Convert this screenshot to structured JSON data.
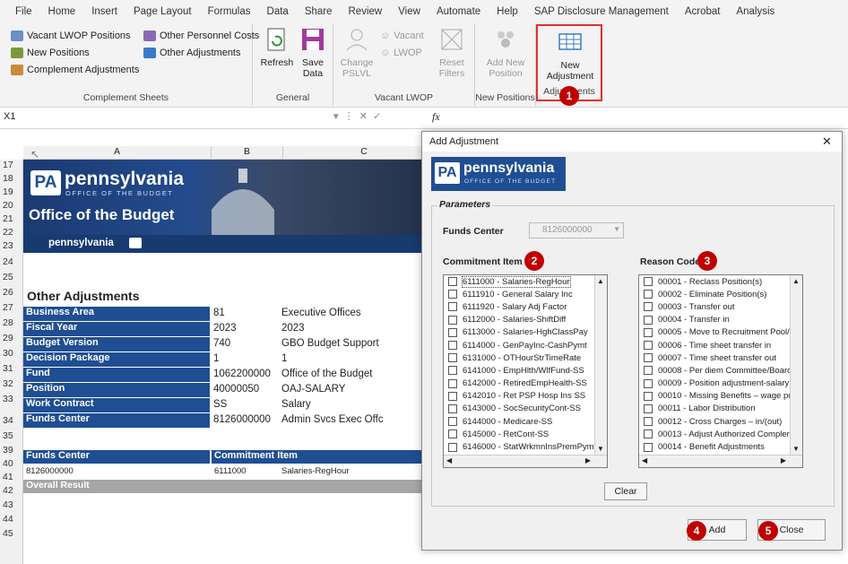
{
  "menu": [
    "File",
    "Home",
    "Insert",
    "Page Layout",
    "Formulas",
    "Data",
    "Share",
    "Review",
    "View",
    "Automate",
    "Help",
    "SAP Disclosure Management",
    "Acrobat",
    "Analysis"
  ],
  "ribbon": {
    "complement": {
      "items": [
        "Vacant LWOP Positions",
        "New Positions",
        "Complement Adjustments",
        "Other Personnel Costs",
        "Other Adjustments"
      ],
      "label": "Complement Sheets"
    },
    "general": {
      "refresh": "Refresh",
      "save1": "Save",
      "save2": "Data",
      "label": "General"
    },
    "vacant": {
      "change1": "Change",
      "change2": "PSLVL",
      "vacant_btn": "Vacant",
      "lwop_btn": "LWOP",
      "reset1": "Reset",
      "reset2": "Filters",
      "label": "Vacant LWOP"
    },
    "newpos": {
      "add1": "Add New",
      "add2": "Position",
      "label": "New Positions"
    },
    "adjust": {
      "new1": "New",
      "new2": "Adjustment",
      "label": "Adjustments"
    }
  },
  "formula": {
    "namebox": "X1",
    "fx": "fx"
  },
  "sheet": {
    "cols": [
      "A",
      "B",
      "C"
    ],
    "rows": [
      "17",
      "18",
      "19",
      "20",
      "21",
      "22",
      "23",
      "24",
      "25",
      "26",
      "27",
      "28",
      "29",
      "30",
      "31",
      "32",
      "33",
      "34",
      "35",
      "39",
      "40",
      "41",
      "42",
      "43",
      "44",
      "45"
    ],
    "banner": {
      "pa": "PA",
      "brand": "pennsylvania",
      "sub": "OFFICE OF THE BUDGET",
      "office": "Office of the Budget",
      "footer": "pennsylvania"
    },
    "title": "Other Adjustments",
    "fields": [
      {
        "label": "Business Area",
        "code": "81",
        "desc": "Executive Offices"
      },
      {
        "label": "Fiscal Year",
        "code": "2023",
        "desc": "2023"
      },
      {
        "label": "Budget Version",
        "code": "740",
        "desc": "GBO Budget Support"
      },
      {
        "label": "Decision Package",
        "code": "1",
        "desc": "1"
      },
      {
        "label": "Fund",
        "code": "1062200000",
        "desc": "Office of the Budget"
      },
      {
        "label": "Position",
        "code": "40000050",
        "desc": "OAJ-SALARY"
      },
      {
        "label": "Work Contract",
        "code": "SS",
        "desc": "Salary"
      },
      {
        "label": "Funds Center",
        "code": "8126000000",
        "desc": "Admin Svcs Exec Offc"
      }
    ],
    "table_head": [
      "Funds Center",
      "Commitment Item"
    ],
    "table_row": [
      "8126000000",
      "6111000",
      "Salaries-RegHour"
    ],
    "overall": "Overall Result"
  },
  "dialog": {
    "title": "Add Adjustment",
    "params": "Parameters",
    "fc_label": "Funds Center",
    "fc_value": "8126000000",
    "ci_label": "Commitment Item",
    "rc_label": "Reason Code",
    "ci_items": [
      "6111000 - Salaries-RegHour",
      "6111910 - General Salary Inc",
      "6111920 - Salary Adj Factor",
      "6112000 - Salaries-ShiftDiff",
      "6113000 - Salaries-HghClassPay",
      "6114000 - GenPayInc-CashPymt",
      "6131000 - OTHourStrTimeRate",
      "6141000 - EmpHlth/WlfFund-SS",
      "6142000 - RetiredEmpHealth-SS",
      "6142010 - Ret PSP Hosp Ins SS",
      "6143000 - SocSecurityCont-SS",
      "6144000 - Medicare-SS",
      "6145000 - RetCont-SS",
      "6146000 - StatWrkmnInsPremPymt"
    ],
    "rc_items": [
      "00001 - Reclass Position(s)",
      "00002 - Eliminate Position(s)",
      "00003 - Transfer out",
      "00004 - Transfer in",
      "00005 - Move to Recruitment Pool/",
      "00006 - Time sheet transfer in",
      "00007 - Time sheet transfer out",
      "00008 - Per diem Committee/Board",
      "00009 - Position adjustment-salary",
      "00010 - Missing Benefits – wage po",
      "00011 - Labor Distribution",
      "00012 - Cross Charges – in/(out)",
      "00013 - Adjust Authorized Compler",
      "00014 - Benefit Adjustments"
    ],
    "clear": "Clear",
    "add": "Add",
    "close": "Close",
    "x": "✕"
  },
  "badges": [
    "1",
    "2",
    "3",
    "4",
    "5"
  ],
  "colors": {
    "accent": "#1f4e93",
    "badge": "#c00000",
    "highlight": "#e03030"
  }
}
